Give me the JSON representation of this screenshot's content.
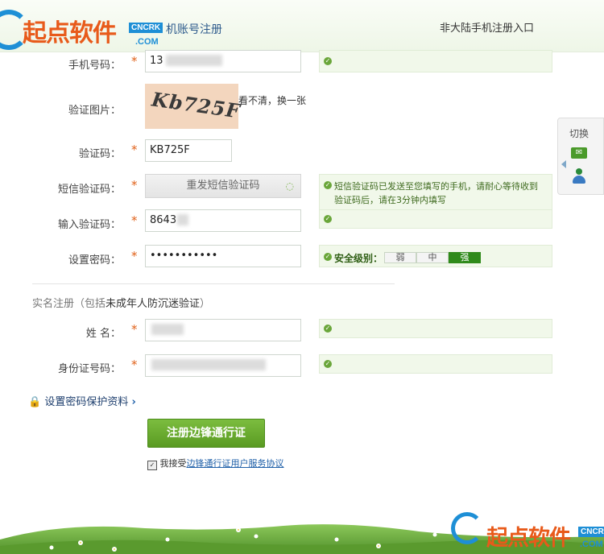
{
  "header": {
    "title": "机账号注册",
    "right_link": "非大陆手机注册入口"
  },
  "watermark": {
    "brand": "起点软件",
    "badge": "CNCRK",
    "com": ".COM"
  },
  "form": {
    "phone": {
      "label": "手机号码：",
      "value": "13"
    },
    "captcha_image": {
      "label": "验证图片：",
      "image_text": "Kb725F",
      "refresh": "看不清，换一张"
    },
    "captcha_code": {
      "label": "验证码：",
      "value": "KB725F"
    },
    "sms": {
      "label": "短信验证码：",
      "button": "重发短信验证码",
      "tip": "短信验证码已发送至您填写的手机，请耐心等待收到验证码后，请在3分钟内填写"
    },
    "sms_input": {
      "label": "输入验证码：",
      "value": "8643"
    },
    "password": {
      "label": "设置密码：",
      "value": "•••••••••••",
      "strength_label": "安全级别：",
      "levels": [
        "弱",
        "中",
        "强"
      ]
    },
    "required_mark": "*"
  },
  "realname": {
    "section_title_prefix": "实名注册（包括",
    "section_title_highlight": "未成年人防沉迷验证",
    "section_title_suffix": "）",
    "name": {
      "label": "姓  名："
    },
    "id": {
      "label": "身份证号码："
    }
  },
  "security_link": "设置密码保护资料",
  "submit_button": "注册边锋通行证",
  "agreement": {
    "prefix": "我接受",
    "link": "边锋通行证用户服务协议"
  },
  "sidepanel": {
    "title": "切换"
  },
  "colors": {
    "accent_green": "#5a9a22",
    "tip_bg": "#f1f8ea",
    "star": "#e0621a",
    "link_blue": "#1e5fa8"
  }
}
